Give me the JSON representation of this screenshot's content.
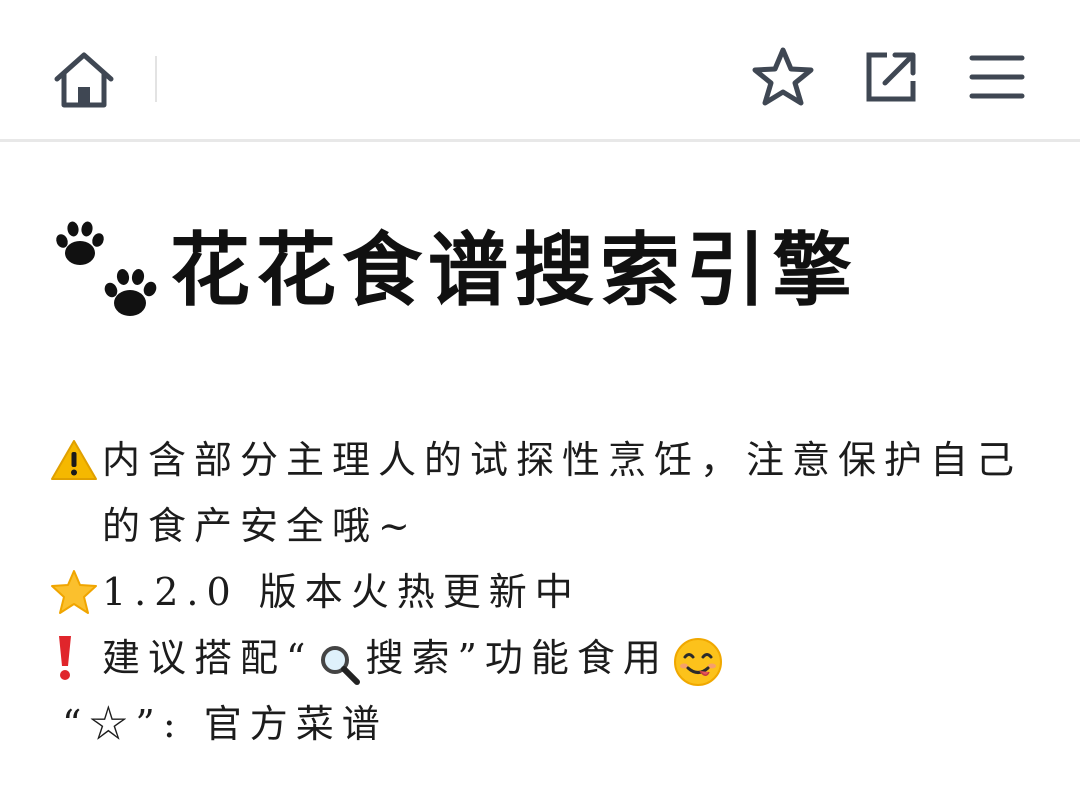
{
  "header": {
    "icons": [
      "home-icon",
      "star-icon",
      "share-icon",
      "menu-icon"
    ]
  },
  "main": {
    "title": "花花食谱搜索引擎",
    "title_icon": "paw-prints-icon",
    "notes": [
      {
        "icon": "warning-icon",
        "text": "内含部分主理人的试探性烹饪，注意保护自己的食产安全哦~"
      },
      {
        "icon": "star-emoji-icon",
        "text": "1.2.0 版本火热更新中"
      },
      {
        "icon": "exclamation-icon",
        "text_before": "建议搭配“",
        "search_word": "搜索",
        "text_after": "”功能食用",
        "trailing_icon": "yum-face-icon"
      },
      {
        "text": "“☆”: 官方菜谱"
      }
    ]
  },
  "colors": {
    "icon_stroke": "#3f4753",
    "warning": "#f5b800",
    "star": "#fbc02d",
    "exclamation": "#e0252b"
  }
}
